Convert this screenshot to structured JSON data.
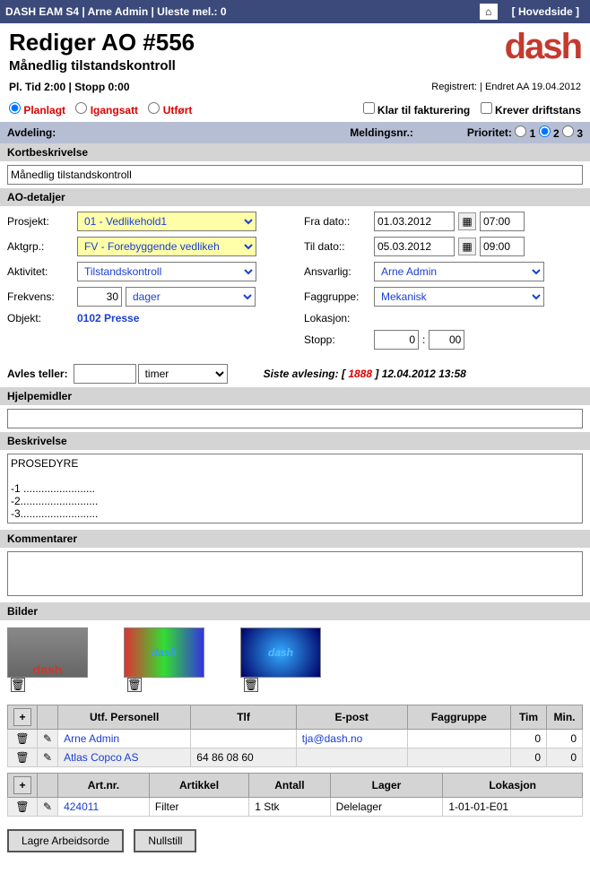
{
  "topbar": {
    "title": "DASH EAM S4 | Arne Admin | Uleste mel.: 0",
    "home": "⌂",
    "hovedside": "[ Hovedside ]"
  },
  "header": {
    "title": "Rediger AO #556",
    "subtitle": "Månedlig tilstandskontroll",
    "logo": "dash"
  },
  "info": {
    "left": "Pl. Tid 2:00 | Stopp 0:00",
    "right": "Registrert: | Endret AA 19.04.2012"
  },
  "status": {
    "planlagt": "Planlagt",
    "igangsatt": "Igangsatt",
    "utfort": "Utført",
    "klar": "Klar til fakturering",
    "krever": "Krever driftstans"
  },
  "gray1": {
    "avdeling": "Avdeling:",
    "meldingsnr": "Meldingsnr.:",
    "prioritet": "Prioritet:"
  },
  "labels": {
    "kortbeskrivelse": "Kortbeskrivelse",
    "ao_detaljer": "AO-detaljer",
    "prosjekt": "Prosjekt:",
    "aktgrp": "Aktgrp.:",
    "aktivitet": "Aktivitet:",
    "frekvens": "Frekvens:",
    "objekt": "Objekt:",
    "fra_dato": "Fra dato::",
    "til_dato": "Til dato::",
    "ansvarlig": "Ansvarlig:",
    "faggruppe": "Faggruppe:",
    "lokasjon": "Lokasjon:",
    "stopp": "Stopp:",
    "avles_teller": "Avles teller:",
    "siste_avlesing_lbl": "Siste avlesing: [",
    "siste_avlesing_close": "]",
    "siste_avlesing_val": "1888",
    "siste_avlesing_date": "12.04.2012 13:58",
    "hjelpemidler": "Hjelpemidler",
    "beskrivelse": "Beskrivelse",
    "kommentarer": "Kommentarer",
    "bilder": "Bilder"
  },
  "values": {
    "kortbeskrivelse": "Månedlig tilstandskontroll",
    "prosjekt": "01 - Vedlikehold1",
    "aktgrp": "FV - Forebyggende vedlikeh",
    "aktivitet": "Tilstandskontroll",
    "frekvens_num": "30",
    "frekvens_unit": "dager",
    "objekt": "0102 Presse",
    "fra_dato": "01.03.2012",
    "fra_tid": "07:00",
    "til_dato": "05.03.2012",
    "til_tid": "09:00",
    "ansvarlig": "Arne Admin",
    "faggruppe": "Mekanisk",
    "stopp_h": "0",
    "stopp_sep": ":",
    "stopp_m": "00",
    "avles_unit": "timer",
    "beskrivelse": "PROSEDYRE\n\n-1 ........................\n-2..........................\n-3..........................",
    "img_text": "dash"
  },
  "personell": {
    "headers": {
      "utf": "Utf. Personell",
      "tlf": "Tlf",
      "epost": "E-post",
      "faggruppe": "Faggruppe",
      "tim": "Tim",
      "min": "Min."
    },
    "rows": [
      {
        "name": "Arne Admin",
        "tlf": "",
        "epost": "tja@dash.no",
        "faggruppe": "",
        "tim": "0",
        "min": "0"
      },
      {
        "name": "Atlas Copco AS",
        "tlf": "64 86 08 60",
        "epost": "",
        "faggruppe": "",
        "tim": "0",
        "min": "0"
      }
    ]
  },
  "artikler": {
    "headers": {
      "artnr": "Art.nr.",
      "artikkel": "Artikkel",
      "antall": "Antall",
      "lager": "Lager",
      "lokasjon": "Lokasjon"
    },
    "rows": [
      {
        "artnr": "424011",
        "artikkel": "Filter",
        "antall": "1 Stk",
        "lager": "Delelager",
        "lokasjon": "1-01-01-E01"
      }
    ]
  },
  "buttons": {
    "lagre": "Lagre Arbeidsorde",
    "nullstill": "Nullstill"
  },
  "icons": {
    "cal": "▦",
    "trash": "🗑",
    "edit": "✎",
    "plus": "+"
  },
  "chart_data": null
}
